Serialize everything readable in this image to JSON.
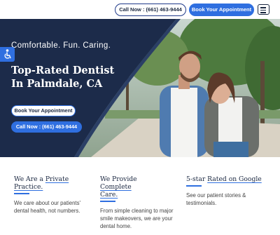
{
  "header": {
    "call_label": "Call Now : (661) 463-9444",
    "appointment_label": "Book Your Appointment"
  },
  "hero": {
    "tagline": "Comfortable. Fun. Caring.",
    "title": "Top-Rated Dentist In Palmdale, CA",
    "appointment_label": "Book Your Appointment",
    "call_label": "Call Now : (661) 463-9444"
  },
  "features": [
    {
      "title_prefix": "We Are a ",
      "title_highlight": "Private Practice.",
      "description": "We care about our patients' dental health, not numbers."
    },
    {
      "title_prefix": "We Provide ",
      "title_highlight": "Complete Care.",
      "description": "From simple cleaning to major smile makeovers, we are your dental home."
    },
    {
      "title_prefix": "5-star ",
      "title_highlight": "Rated on Google",
      "description": "See our patient stories & testimonials."
    }
  ],
  "colors": {
    "accent": "#2f6fe0",
    "navy": "#1c2b4a",
    "text": "#1a2740"
  },
  "icons": {
    "menu": "hamburger-menu-icon",
    "accessibility": "accessibility-icon"
  }
}
